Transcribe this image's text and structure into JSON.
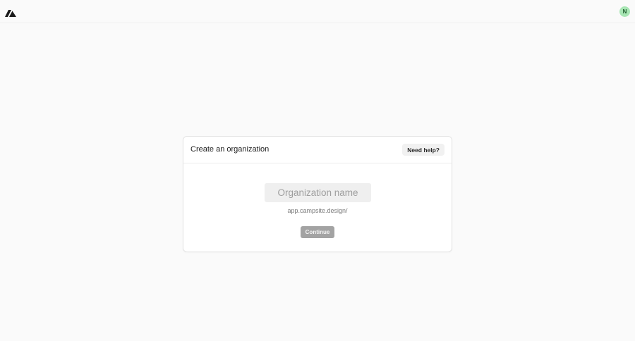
{
  "header": {
    "logo_icon": "campsite-logo-icon",
    "avatar_initial": "N",
    "avatar_color": "#a8e6b4"
  },
  "card": {
    "title": "Create an organization",
    "help_label": "Need help?",
    "org_name_placeholder": "Organization name",
    "org_name_value": "",
    "url_prefix": "app.campsite.design/",
    "continue_label": "Continue",
    "continue_color": "#a3a3a3"
  }
}
